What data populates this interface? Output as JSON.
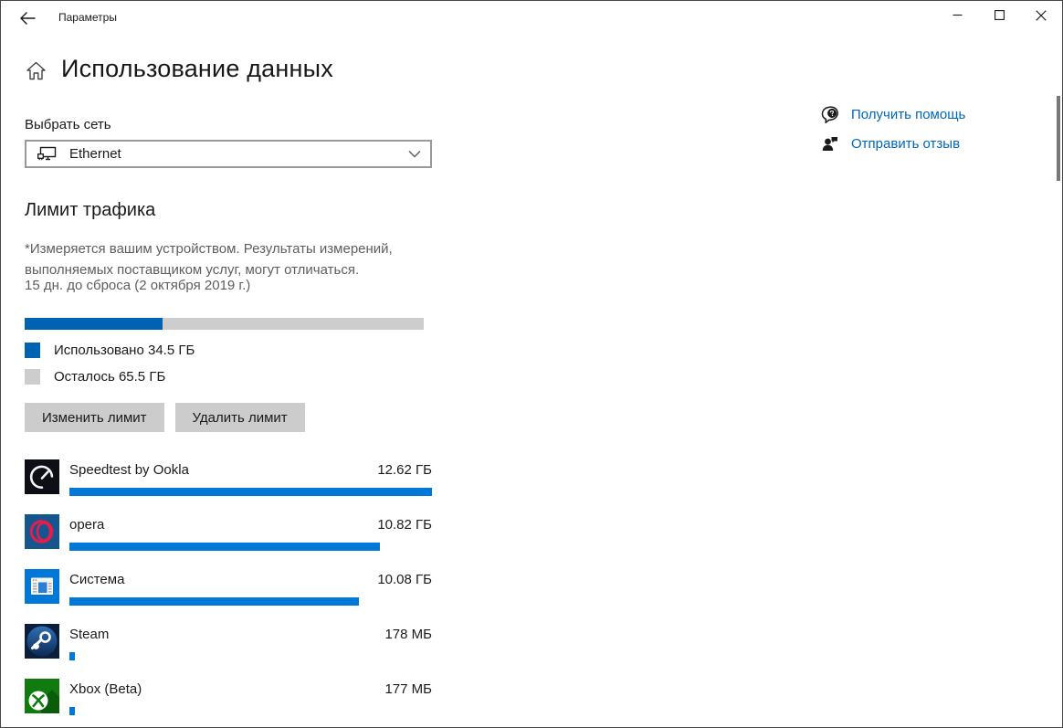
{
  "titlebar": {
    "title": "Параметры",
    "icons": [
      "back-arrow-icon",
      "minimize-icon",
      "maximize-icon",
      "close-icon"
    ]
  },
  "page": {
    "title": "Использование данных",
    "home_icon": "home-icon"
  },
  "network": {
    "label": "Выбрать сеть",
    "selected": "Ethernet",
    "icon": "ethernet-icon",
    "chevron_icon": "chevron-down-icon"
  },
  "help_links": {
    "get_help": {
      "label": "Получить помощь",
      "icon": "help-bubble-icon"
    },
    "send_feedback": {
      "label": "Отправить отзыв",
      "icon": "feedback-person-icon"
    }
  },
  "data_limit": {
    "heading": "Лимит трафика",
    "note": [
      "*Измеряется вашим устройством. Результаты измерений,",
      "выполняемых поставщиком услуг, могут отличаться."
    ],
    "reset_info": "15 дн. до сброса (2 октября 2019 г.)",
    "used_percent": 34.5,
    "used_label": "Использовано 34.5 ГБ",
    "remaining_label": "Осталось 65.5 ГБ",
    "edit_button": "Изменить лимит",
    "delete_button": "Удалить лимит"
  },
  "apps": [
    {
      "name": "Speedtest by Ookla",
      "usage": "12.62 ГБ",
      "bar_percent": 100,
      "icon": "speedtest-icon"
    },
    {
      "name": "opera",
      "usage": "10.82 ГБ",
      "bar_percent": 85.7,
      "icon": "opera-icon"
    },
    {
      "name": "Система",
      "usage": "10.08 ГБ",
      "bar_percent": 79.9,
      "icon": "windows-system-icon"
    },
    {
      "name": "Steam",
      "usage": "178 МБ",
      "bar_percent": 1.4,
      "icon": "steam-icon"
    },
    {
      "name": "Xbox (Beta)",
      "usage": "177 МБ",
      "bar_percent": 1.4,
      "icon": "xbox-icon"
    }
  ],
  "colors": {
    "accent_dark_blue": "#0063b1",
    "app_bar_blue": "#0078d7",
    "link_blue": "#0067b8",
    "track_gray": "#cdcdcd",
    "button_gray": "#cccccc"
  }
}
